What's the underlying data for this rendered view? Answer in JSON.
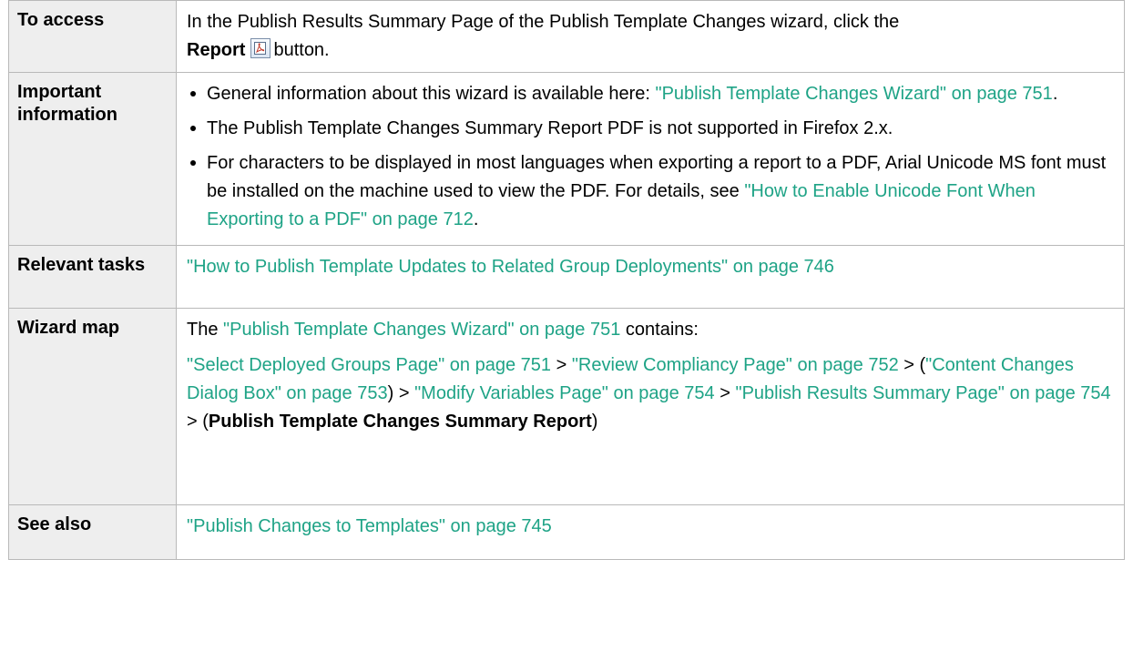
{
  "rows": {
    "access": {
      "label": "To access",
      "text_before": "In the Publish Results Summary Page of the Publish Template Changes wizard, click the",
      "bold": "Report",
      "icon": "pdf-report-icon",
      "text_after": "button."
    },
    "important": {
      "label": "Important information",
      "bullets": [
        {
          "before": "General information about this wizard is available here: ",
          "link": "\"Publish Template Changes Wizard\" on page 751",
          "after": "."
        },
        {
          "text": "The Publish Template Changes Summary Report PDF is not supported in Firefox 2.x."
        },
        {
          "before": "For characters to be displayed in most languages when exporting a report to a PDF, Arial Unicode MS font must be installed on the machine used to view the PDF. For details, see ",
          "link": "\"How to Enable Unicode Font When Exporting to a PDF\" on page 712",
          "after": "."
        }
      ]
    },
    "relevant": {
      "label": "Relevant tasks",
      "link": "\"How to Publish Template Updates to Related Group Deployments\" on page 746"
    },
    "wizard": {
      "label": "Wizard map",
      "line1_before": "The ",
      "line1_link": "\"Publish Template Changes Wizard\" on page 751",
      "line1_after": " contains:",
      "link_select": "\"Select Deployed Groups Page\" on page 751",
      "sep1": " > ",
      "link_review": "\"Review Compliancy Page\" on page 752",
      "sep2": " > (",
      "link_content": "\"Content Changes Dialog Box\" on page 753",
      "sep3": ") > ",
      "link_modify": "\"Modify Variables Page\" on page 754",
      "sep4": " > ",
      "link_publish": "\"Publish Results Summary Page\" on page 754",
      "sep5": " > (",
      "bold_final": "Publish Template Changes Summary Report",
      "sep6": ")"
    },
    "see_also": {
      "label": "See also",
      "link": "\"Publish Changes to Templates\" on page 745"
    }
  },
  "colors": {
    "link": "#1ea386",
    "label_background": "#eeeeee",
    "border": "#b9b9b9"
  }
}
